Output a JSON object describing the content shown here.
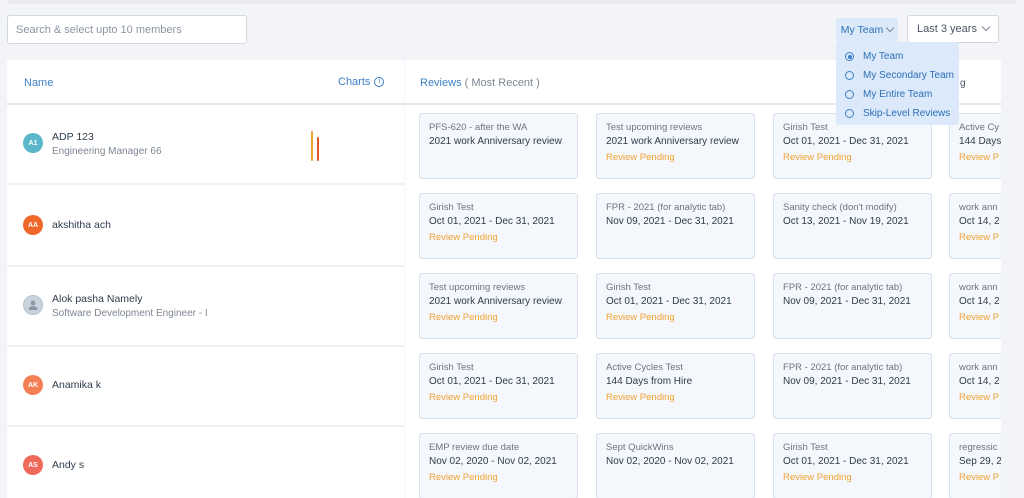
{
  "search": {
    "placeholder": "Search & select upto 10 members"
  },
  "filters": {
    "team_label": "My Team",
    "period_label": "Last 3 years",
    "team_options": [
      {
        "label": "My Team",
        "selected": true
      },
      {
        "label": "My Secondary Team",
        "selected": false
      },
      {
        "label": "My Entire Team",
        "selected": false
      },
      {
        "label": "Skip-Level Reviews",
        "selected": false
      }
    ]
  },
  "table": {
    "name_header": "Name",
    "charts_header": "Charts",
    "reviews_header": "Reviews",
    "reviews_subheader": "( Most Recent )",
    "reviews_header_trail": "g"
  },
  "colors": {
    "accent": "#3b7fc4",
    "pending": "#f1a232"
  },
  "members": [
    {
      "initials": "A1",
      "avatar_color": "#5cb6c9",
      "name": "ADP 123",
      "title": "Engineering Manager 66",
      "chart_bars": [
        {
          "color": "#f1a232",
          "level": 1.0
        },
        {
          "color": "#e2561f",
          "level": 0.8
        }
      ],
      "reviews": [
        {
          "title": "PFS-620 - after the WA",
          "sub": "2021 work Anniversary review",
          "status": ""
        },
        {
          "title": "Test upcoming reviews",
          "sub": "2021 work Anniversary review",
          "status": "Review Pending"
        },
        {
          "title": "Girish Test",
          "sub": "Oct 01, 2021 - Dec 31, 2021",
          "status": "Review Pending"
        },
        {
          "title": "Active Cy",
          "sub": "144 Days",
          "status": "Review P"
        }
      ]
    },
    {
      "initials": "AA",
      "avatar_color": "#f0672a",
      "name": "akshitha ach",
      "title": "",
      "chart_bars": [],
      "reviews": [
        {
          "title": "Girish Test",
          "sub": "Oct 01, 2021 - Dec 31, 2021",
          "status": "Review Pending"
        },
        {
          "title": "FPR - 2021 (for analytic tab)",
          "sub": "Nov 09, 2021 - Dec 31, 2021",
          "status": ""
        },
        {
          "title": "Sanity check (don't modify)",
          "sub": "Oct 13, 2021 - Nov 19, 2021",
          "status": ""
        },
        {
          "title": "work ann",
          "sub": "Oct 14, 2",
          "status": "Review P"
        }
      ]
    },
    {
      "initials": "",
      "avatar_color": "#c9d3dd",
      "name": "Alok pasha Namely",
      "title": "Software Development Engineer - I",
      "chart_bars": [],
      "reviews": [
        {
          "title": "Test upcoming reviews",
          "sub": "2021 work Anniversary review",
          "status": "Review Pending"
        },
        {
          "title": "Girish Test",
          "sub": "Oct 01, 2021 - Dec 31, 2021",
          "status": "Review Pending"
        },
        {
          "title": "FPR - 2021 (for analytic tab)",
          "sub": "Nov 09, 2021 - Dec 31, 2021",
          "status": ""
        },
        {
          "title": "work ann",
          "sub": "Oct 14, 2",
          "status": "Review P"
        }
      ]
    },
    {
      "initials": "AK",
      "avatar_color": "#f37f55",
      "name": "Anamika k",
      "title": "",
      "chart_bars": [],
      "reviews": [
        {
          "title": "Girish Test",
          "sub": "Oct 01, 2021 - Dec 31, 2021",
          "status": "Review Pending"
        },
        {
          "title": "Active Cycles Test",
          "sub": "144 Days from Hire",
          "status": "Review Pending"
        },
        {
          "title": "FPR - 2021 (for analytic tab)",
          "sub": "Nov 09, 2021 - Dec 31, 2021",
          "status": ""
        },
        {
          "title": "work ann",
          "sub": "Oct 14, 2",
          "status": "Review P"
        }
      ]
    },
    {
      "initials": "AS",
      "avatar_color": "#ef6a5a",
      "name": "Andy s",
      "title": "",
      "chart_bars": [],
      "reviews": [
        {
          "title": "EMP review due date",
          "sub": "Nov 02, 2020 - Nov 02, 2021",
          "status": "Review Pending"
        },
        {
          "title": "Sept QuickWins",
          "sub": "Nov 02, 2020 - Nov 02, 2021",
          "status": ""
        },
        {
          "title": "Girish Test",
          "sub": "Oct 01, 2021 - Dec 31, 2021",
          "status": "Review Pending"
        },
        {
          "title": "regressic",
          "sub": "Sep 29, 2",
          "status": "Review P"
        }
      ]
    }
  ]
}
